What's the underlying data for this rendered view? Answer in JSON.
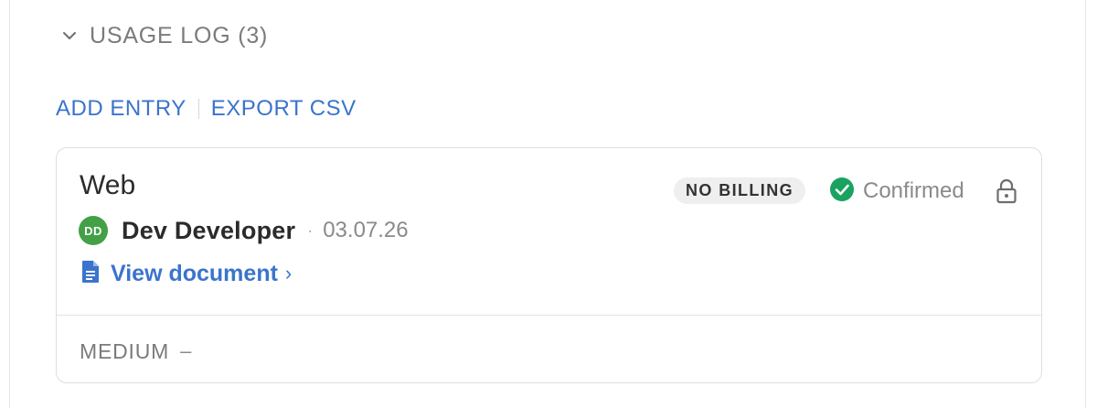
{
  "section": {
    "title": "USAGE LOG (3)",
    "icon": "chevron-down-icon"
  },
  "actions": {
    "add_label": "ADD ENTRY",
    "export_label": "EXPORT CSV"
  },
  "entry": {
    "title": "Web",
    "badge": "NO BILLING",
    "status": "Confirmed",
    "status_color": "#1aa260",
    "lock_icon": "lock-icon",
    "author": {
      "initials": "DD",
      "name": "Dev Developer",
      "avatar_color": "#43a047"
    },
    "separator": "·",
    "date": "03.07.26",
    "document_link": "View document",
    "document_link_chevron": "›",
    "priority_label": "MEDIUM",
    "priority_value": "–"
  },
  "colors": {
    "link": "#3a74cc",
    "muted": "#7b7b7b"
  }
}
